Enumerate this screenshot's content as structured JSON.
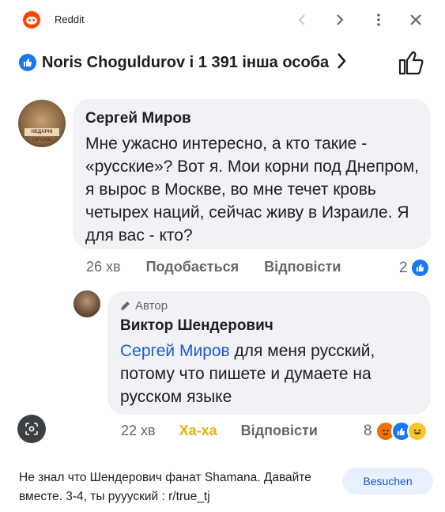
{
  "app": {
    "title": "Reddit"
  },
  "likes": {
    "text": "Noris Choguldurov і 1 391 інша особа"
  },
  "comment1": {
    "author": "Сергей Миров",
    "text": "Мне ужасно интересно, а кто такие - «русские»? Вот я. Мои корни под Днепром, я вырос в Москве, во мне течет кровь четырех наций, сейчас живу в Израиле. Я для вас - кто?",
    "avatar_label": "НЕДАРНІ ПІРОЖИ",
    "time": "26 хв",
    "like_label": "Подобається",
    "reply_label": "Відповісти",
    "reaction_count": "2"
  },
  "comment2": {
    "author_tag": "Автор",
    "author": "Виктор Шендерович",
    "mention": "Сергей Миров",
    "text": " для меня русский, потому что пишете и думаете на русском языке",
    "time": "22 хв",
    "haha_label": "Ха-ха",
    "reply_label": "Відповісти",
    "reaction_count": "8"
  },
  "caption": "Не знал что Шендерович фанат Shamana. Давайте вместе. 3-4, ты руууский : r/true_tj",
  "visit_label": "Besuchen",
  "colors": {
    "facebook_blue": "#1877f2",
    "reddit_orange": "#ff4500",
    "bubble_gray": "#f0f2f5",
    "mention_blue": "#1a5bd1"
  }
}
